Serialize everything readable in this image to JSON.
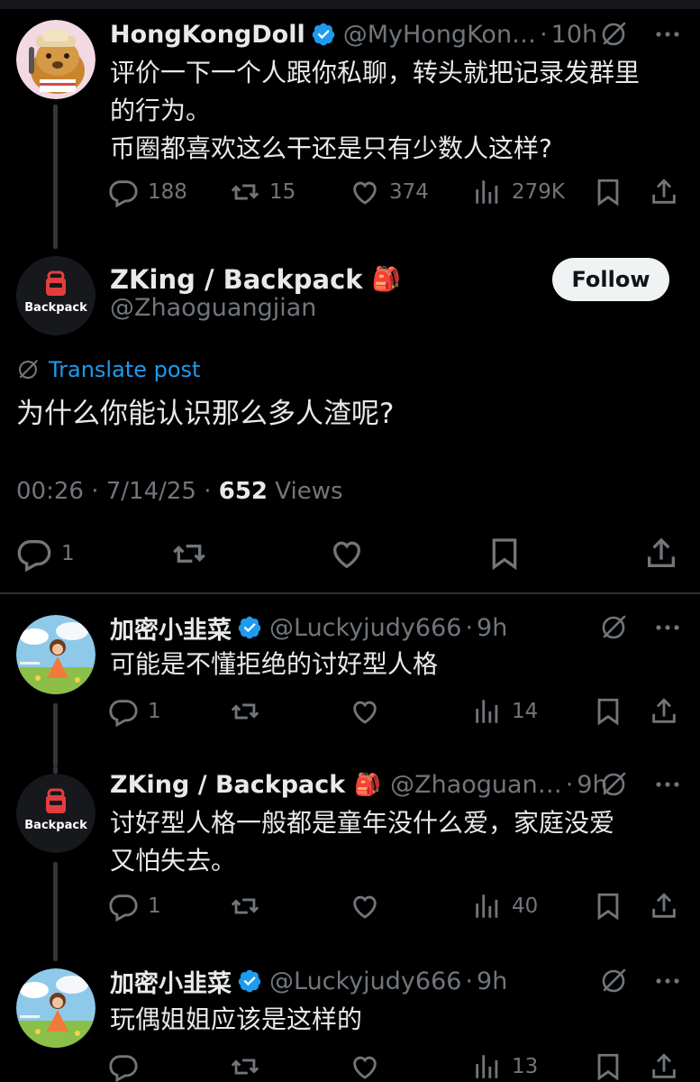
{
  "tweet1": {
    "name": "HongKongDoll",
    "handle": "@MyHongKon…",
    "time": "10h",
    "text_line1": "评价一下一个人跟你私聊，转头就把记录发群里",
    "text_line2": "的行为。",
    "text_line3": "币圈都喜欢这么干还是只有少数人这样?",
    "replies": "188",
    "reposts": "15",
    "likes": "374",
    "views": "279K"
  },
  "main": {
    "name": "ZKing / Backpack",
    "emoji": "🎒",
    "handle": "@Zhaoguangjian",
    "follow_label": "Follow",
    "translate_label": "Translate post",
    "text": "为什么你能认识那么多人渣呢?",
    "timestamp": "00:26 · 7/14/25 · ",
    "views_count": "652",
    "views_label": " Views",
    "replies": "1",
    "avatar_label": "Backpack"
  },
  "reply1": {
    "name": "加密小韭菜",
    "handle": "@Luckyjudy666",
    "time": "9h",
    "text": "可能是不懂拒绝的讨好型人格",
    "replies": "1",
    "views": "14"
  },
  "reply2": {
    "name": "ZKing / Backpack",
    "emoji": "🎒",
    "handle": "@Zhaoguan…",
    "time": "9h",
    "text_line1": "讨好型人格一般都是童年没什么爱，家庭没爱",
    "text_line2": "又怕失去。",
    "replies": "1",
    "views": "40",
    "avatar_label": "Backpack"
  },
  "reply3": {
    "name": "加密小韭菜",
    "handle": "@Luckyjudy666",
    "time": "9h",
    "text": "玩偶姐姐应该是这样的",
    "views": "13"
  },
  "colors": {
    "background": "#000000",
    "text": "#e7e9ea",
    "muted": "#71767b",
    "accent": "#1d9bf0",
    "verified": "#1d9bf0"
  },
  "icons": [
    "verified-badge-icon",
    "grok-icon",
    "more-icon",
    "reply-icon",
    "repost-icon",
    "like-icon",
    "views-icon",
    "bookmark-icon",
    "share-icon",
    "backpack-logo-icon"
  ]
}
